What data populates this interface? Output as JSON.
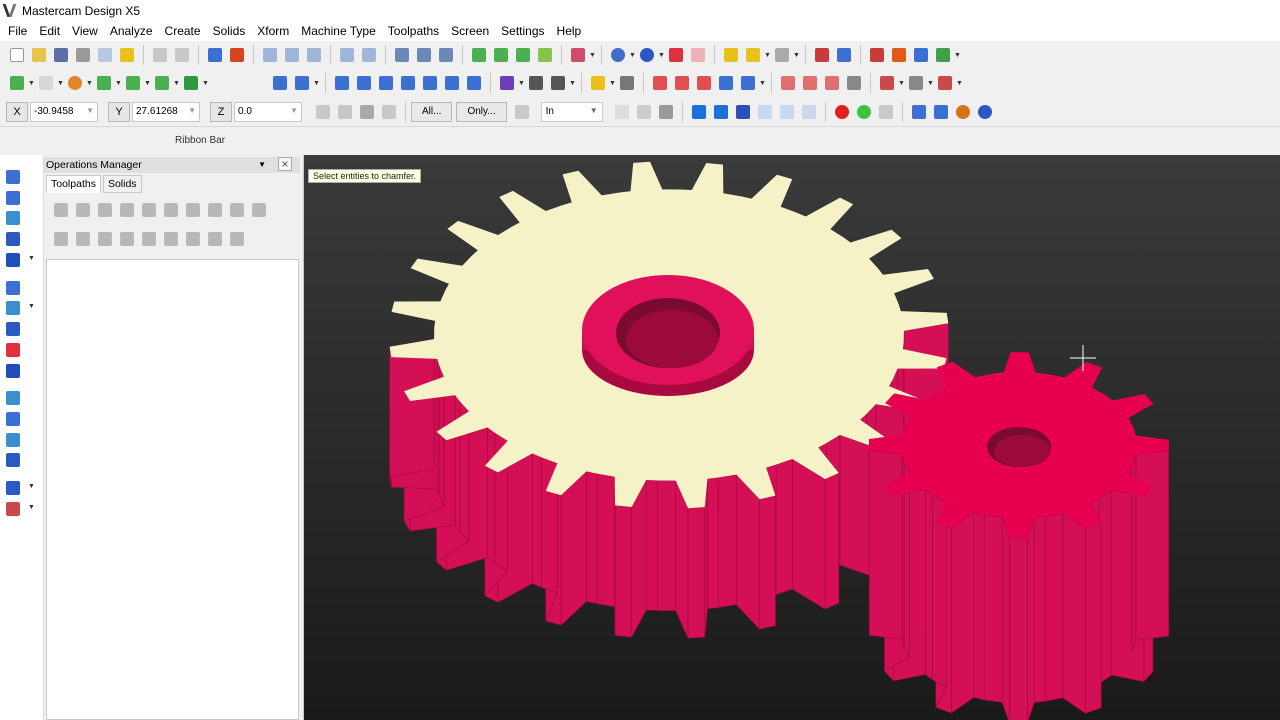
{
  "window": {
    "title": "Mastercam Design X5"
  },
  "menu": [
    "File",
    "Edit",
    "View",
    "Analyze",
    "Create",
    "Solids",
    "Xform",
    "Machine Type",
    "Toolpaths",
    "Screen",
    "Settings",
    "Help"
  ],
  "coords": {
    "x_label": "X",
    "x_value": "-30.9458",
    "y_label": "Y",
    "y_value": "27.61268",
    "z_label": "Z",
    "z_value": "0.0"
  },
  "selection": {
    "all_label": "All...",
    "only_label": "Only..."
  },
  "units": {
    "selected": "In"
  },
  "ribbon": {
    "label": "Ribbon Bar"
  },
  "operations_manager": {
    "title": "Operations Manager",
    "tabs": [
      "Toolpaths",
      "Solids"
    ]
  },
  "viewport": {
    "prompt": "Select entities to chamfer.",
    "large_gear_teeth": 24,
    "small_gear_teeth": 12,
    "colors": {
      "gear_side": "#d40f55",
      "gear_top": "#f5f2c8",
      "small_gear_top": "#e6004f",
      "background": "#2a2a2a"
    }
  }
}
